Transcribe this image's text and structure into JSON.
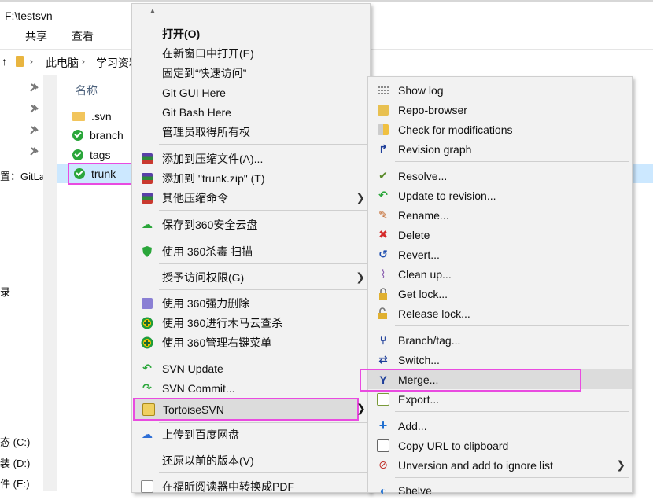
{
  "window": {
    "title": "F:\\testsvn"
  },
  "ribbon": {
    "tabs": [
      "共享",
      "查看"
    ]
  },
  "address": {
    "segments": [
      "此电脑",
      "学习资料"
    ]
  },
  "file_list": {
    "header": "名称",
    "items": [
      ".svn",
      "branch",
      "tags",
      "trunk"
    ]
  },
  "nav": {
    "items": [
      "置：GitLa",
      "录",
      "态 (C:)",
      "装 (D:)",
      "件 (E:)"
    ]
  },
  "context_menu": {
    "items": [
      "打开(O)",
      "在新窗口中打开(E)",
      "固定到“快速访问”",
      "Git GUI Here",
      "Git Bash Here",
      "管理员取得所有权",
      "添加到压缩文件(A)...",
      "添加到 \"trunk.zip\" (T)",
      "其他压缩命令",
      "保存到360安全云盘",
      "使用 360杀毒 扫描",
      "授予访问权限(G)",
      "使用 360强力删除",
      "使用 360进行木马云查杀",
      "使用 360管理右键菜单",
      "SVN Update",
      "SVN Commit...",
      "TortoiseSVN",
      "上传到百度网盘",
      "还原以前的版本(V)",
      "在福昕阅读器中转换成PDF"
    ]
  },
  "tortoise_menu": {
    "items": [
      "Show log",
      "Repo-browser",
      "Check for modifications",
      "Revision graph",
      "Resolve...",
      "Update to revision...",
      "Rename...",
      "Delete",
      "Revert...",
      "Clean up...",
      "Get lock...",
      "Release lock...",
      "Branch/tag...",
      "Switch...",
      "Merge...",
      "Export...",
      "Add...",
      "Copy URL to clipboard",
      "Unversion and add to ignore list",
      "Shelve"
    ]
  },
  "colors": {
    "highlight_border": "#e94be0",
    "selection": "#cce8ff",
    "menu_bg": "#f2f2f2"
  }
}
